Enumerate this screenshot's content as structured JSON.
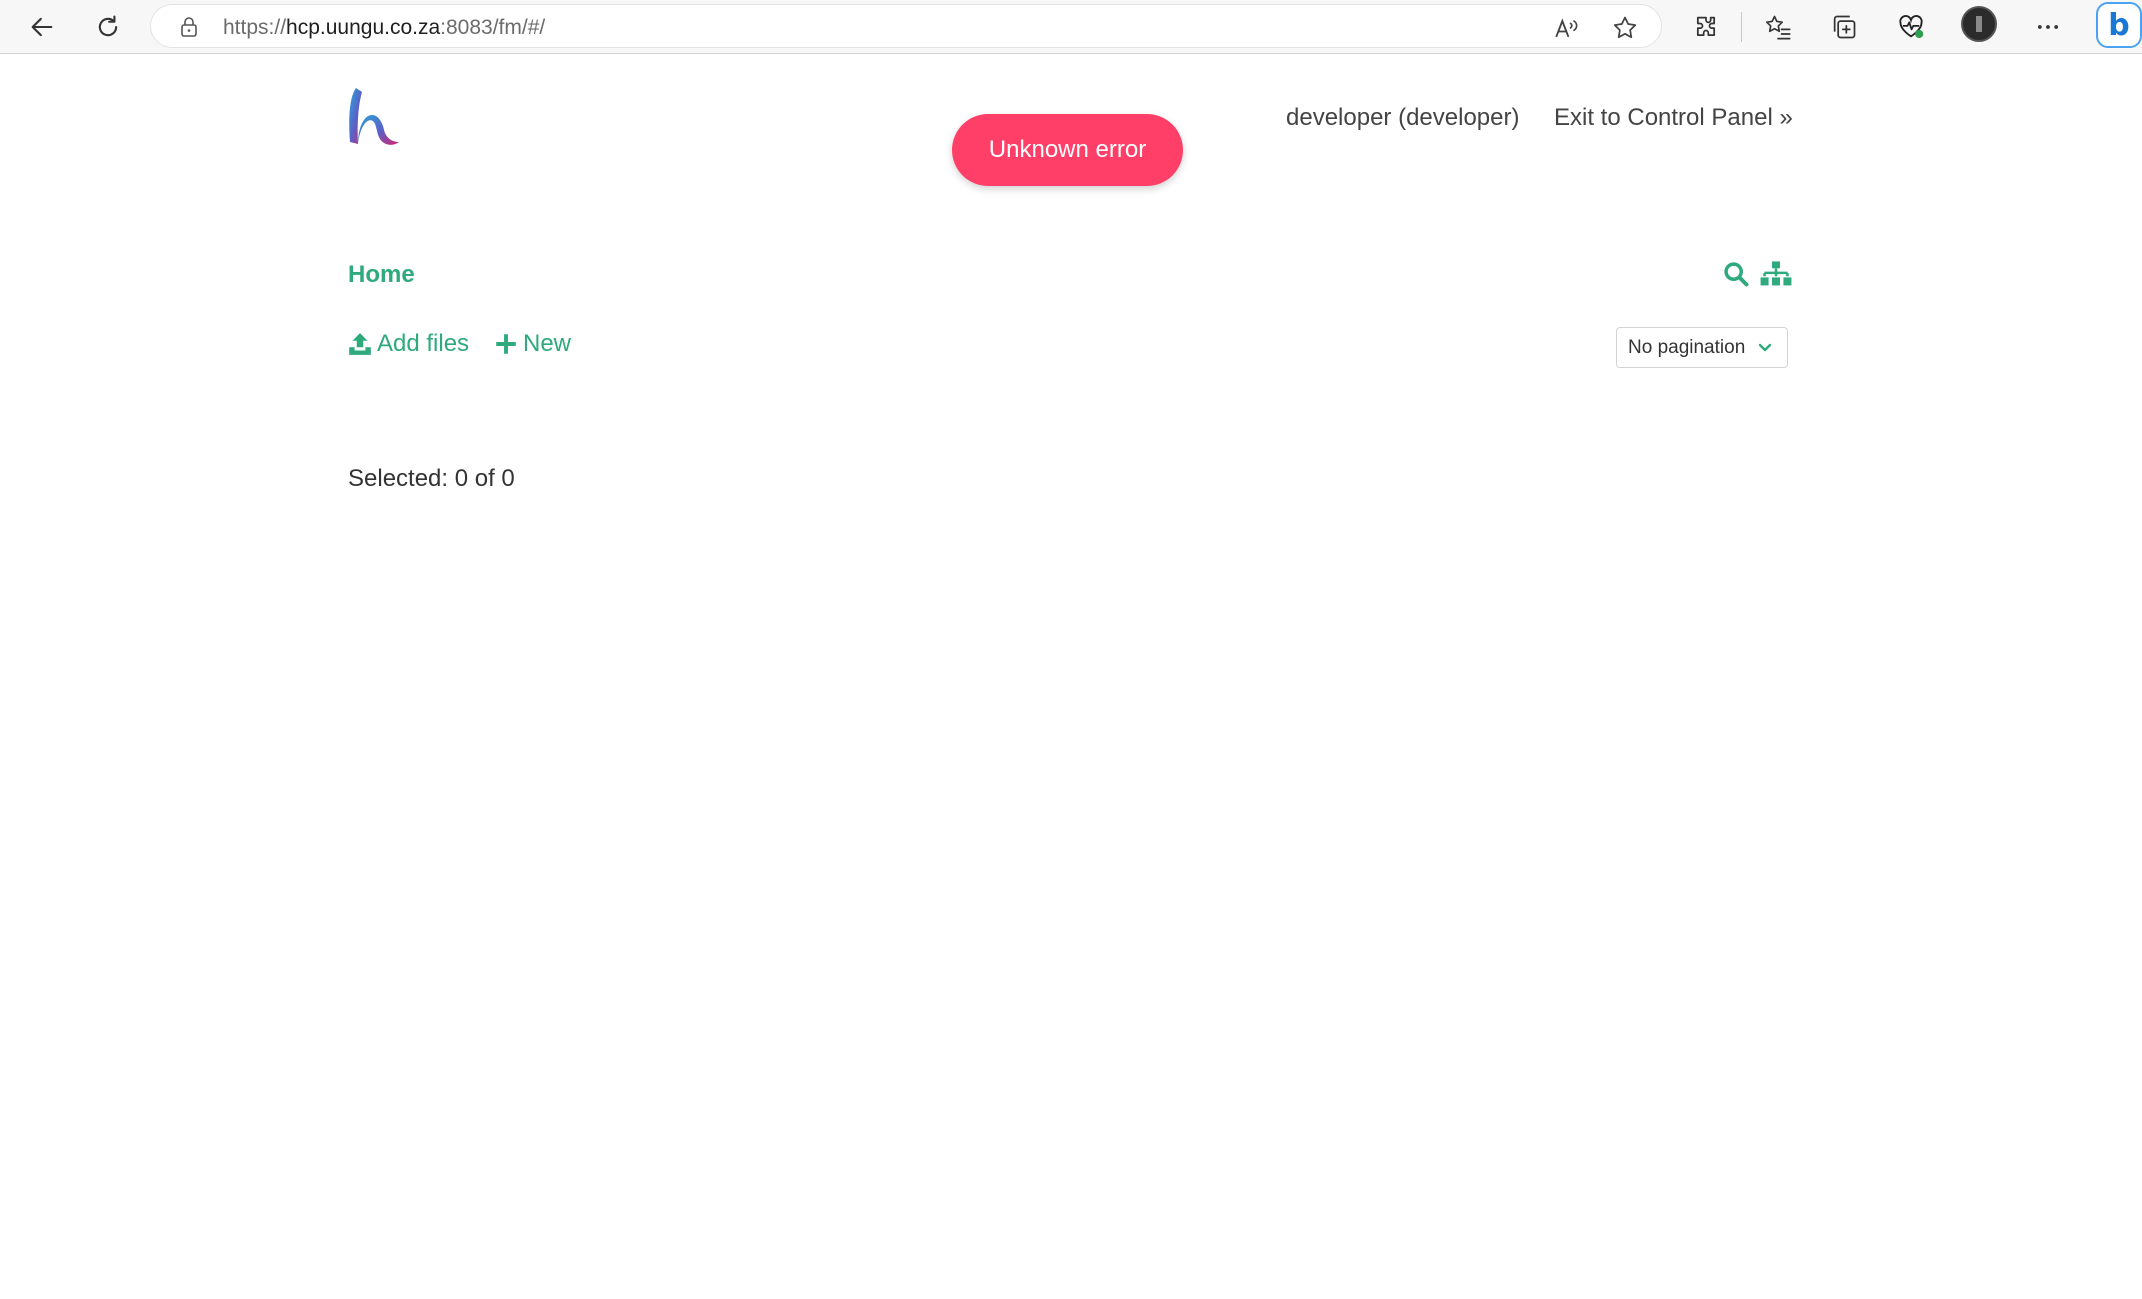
{
  "browser": {
    "url_prefix": "https://",
    "url_host": "hcp.uungu.co.za",
    "url_rest": ":8083/fm/#/",
    "icons": [
      "back-icon",
      "refresh-icon",
      "lock-icon",
      "read-aloud-icon",
      "favorite-star-icon",
      "extensions-icon",
      "favorites-icon",
      "collections-icon",
      "browser-essentials-icon",
      "profile-icon",
      "more-icon",
      "bing-icon"
    ]
  },
  "header": {
    "error_message": "Unknown error",
    "user_label": "developer (developer)",
    "exit_link": "Exit to Control Panel »"
  },
  "breadcrumb": {
    "home": "Home"
  },
  "toolbar": {
    "add_files": "Add files",
    "new": "New",
    "pagination_selected": "No pagination"
  },
  "status": {
    "selected_text": "Selected: 0 of 0"
  },
  "colors": {
    "accent_green": "#2eaa7c",
    "error_pink": "#ff3f68"
  }
}
